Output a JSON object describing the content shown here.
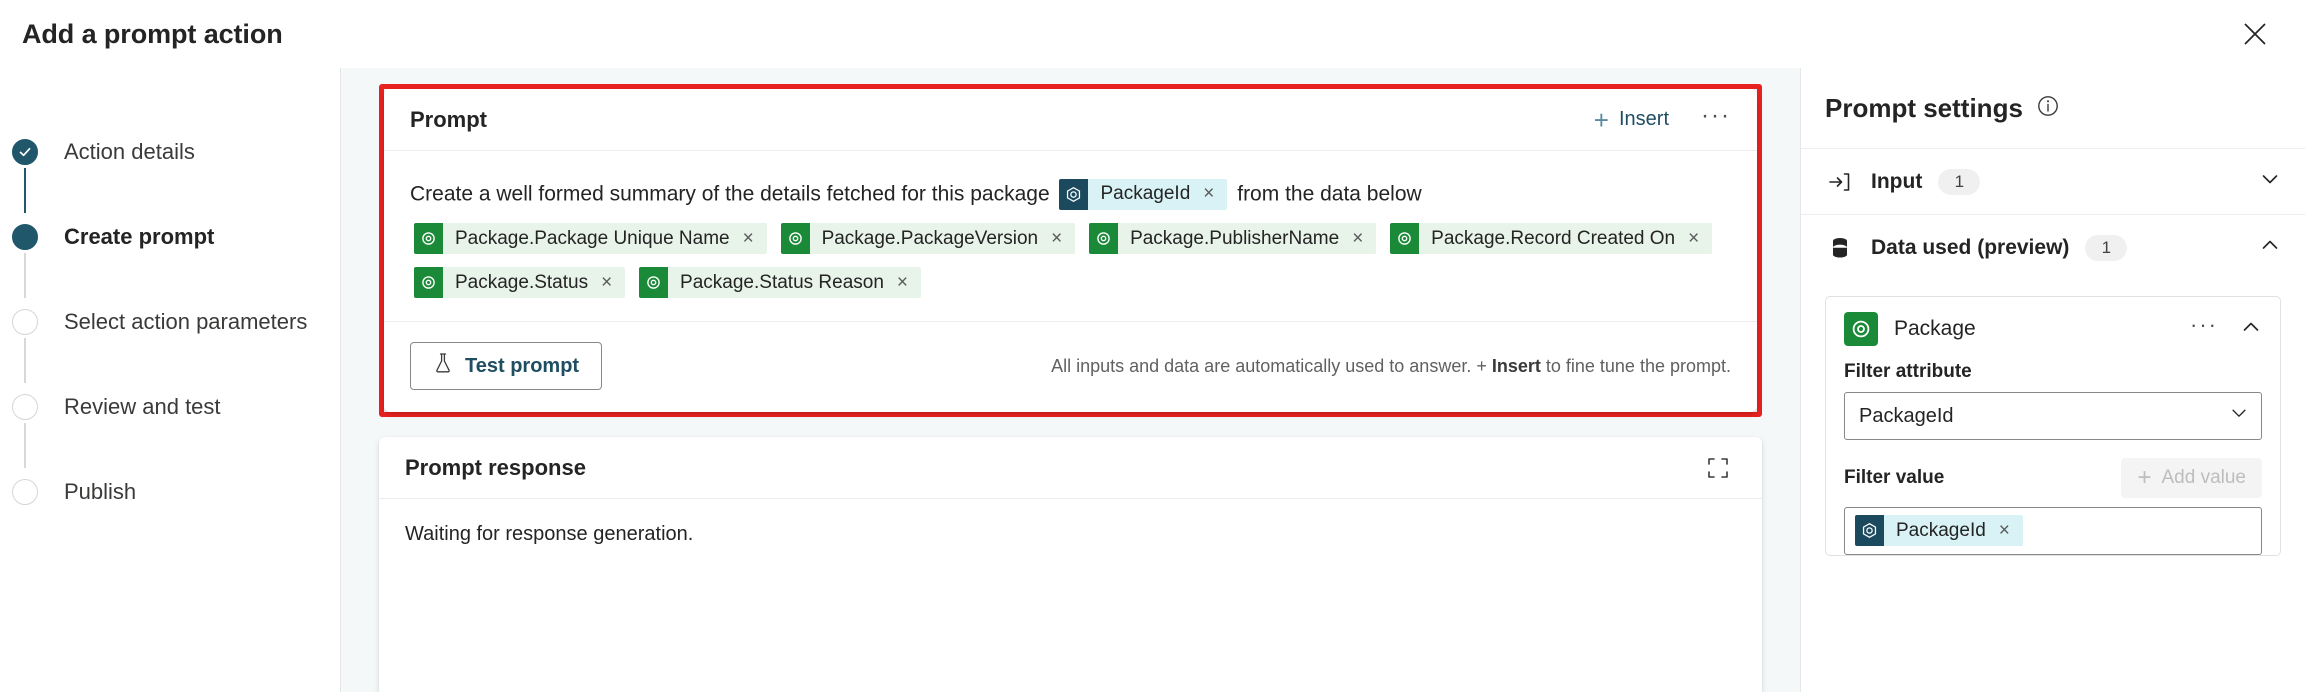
{
  "window": {
    "title": "Add a prompt action",
    "close_icon": "close-icon"
  },
  "wizard": {
    "steps": [
      {
        "label": "Action details",
        "state": "done"
      },
      {
        "label": "Create prompt",
        "state": "active"
      },
      {
        "label": "Select action parameters",
        "state": "todo"
      },
      {
        "label": "Review and test",
        "state": "todo"
      },
      {
        "label": "Publish",
        "state": "todo"
      }
    ]
  },
  "prompt_card": {
    "title": "Prompt",
    "insert_label": "Insert",
    "more_label": "···",
    "text_before": "Create a well formed summary of the details fetched for this package",
    "text_after": "from the data below",
    "inline_token": {
      "label": "PackageId",
      "color": "blue",
      "close": "×"
    },
    "tokens": [
      {
        "label": "Package.Package Unique Name",
        "color": "green",
        "close": "×"
      },
      {
        "label": "Package.PackageVersion",
        "color": "green",
        "close": "×"
      },
      {
        "label": "Package.PublisherName",
        "color": "green",
        "close": "×"
      },
      {
        "label": "Package.Record Created On",
        "color": "green",
        "close": "×"
      },
      {
        "label": "Package.Status",
        "color": "green",
        "close": "×"
      },
      {
        "label": "Package.Status Reason",
        "color": "green",
        "close": "×"
      }
    ],
    "test_button": "Test prompt",
    "hint_prefix": "All inputs and data are automatically used to answer. + ",
    "hint_bold": "Insert",
    "hint_suffix": " to fine tune the prompt."
  },
  "response_card": {
    "title": "Prompt response",
    "body": "Waiting for response generation."
  },
  "settings": {
    "title": "Prompt settings",
    "info_icon": "info-icon",
    "sections": [
      {
        "label": "Input",
        "count": "1",
        "icon": "input-arrow-icon",
        "expanded": false
      },
      {
        "label": "Data used (preview)",
        "count": "1",
        "icon": "database-icon",
        "expanded": true
      }
    ],
    "entity": {
      "name": "Package",
      "more_label": "···",
      "filter_attribute_label": "Filter attribute",
      "filter_attribute_value": "PackageId",
      "filter_value_label": "Filter value",
      "add_value_label": "Add value",
      "filter_value_token": {
        "label": "PackageId",
        "color": "blue",
        "close": "×"
      }
    }
  },
  "colors": {
    "accent": "#20576b",
    "highlight": "#e8221f",
    "green_token": "#1a8a38",
    "blue_token": "#1b4a5e",
    "canvas_bg": "#f5f8f9"
  }
}
